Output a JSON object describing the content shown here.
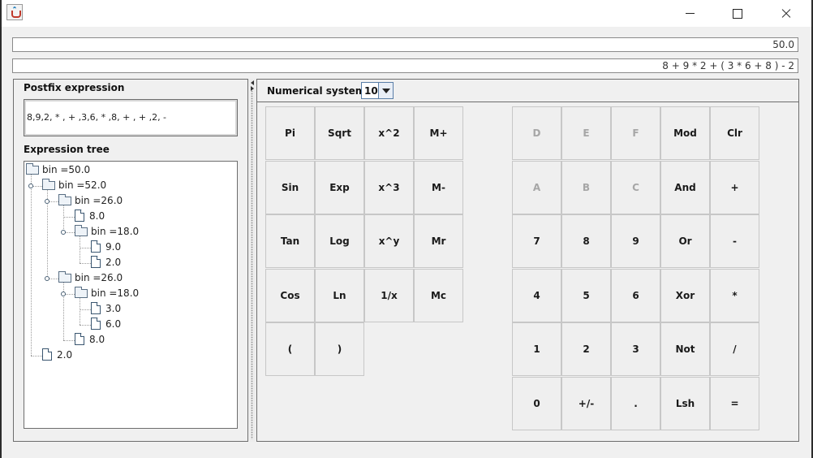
{
  "window": {
    "minimize_icon": "minimize-icon",
    "maximize_icon": "maximize-icon",
    "close_icon": "close-icon",
    "app_icon": "java-app-icon"
  },
  "display": {
    "result": "50.0",
    "expression": "8 + 9 * 2 + ( 3 * 6 + 8 ) - 2"
  },
  "postfix": {
    "title": "Postfix expression",
    "value": "8,9,2, * , + ,3,6, * ,8, + , + ,2, -"
  },
  "tree": {
    "title": "Expression tree",
    "nodes": [
      {
        "label": "bin =50.0",
        "kind": "folder"
      },
      {
        "label": "bin =52.0",
        "kind": "folder"
      },
      {
        "label": "bin =26.0",
        "kind": "folder"
      },
      {
        "label": "8.0",
        "kind": "file"
      },
      {
        "label": "bin =18.0",
        "kind": "folder"
      },
      {
        "label": "9.0",
        "kind": "file"
      },
      {
        "label": "2.0",
        "kind": "file"
      },
      {
        "label": "bin =26.0",
        "kind": "folder"
      },
      {
        "label": "bin =18.0",
        "kind": "folder"
      },
      {
        "label": "3.0",
        "kind": "file"
      },
      {
        "label": "6.0",
        "kind": "file"
      },
      {
        "label": "8.0",
        "kind": "file"
      },
      {
        "label": "2.0",
        "kind": "file"
      }
    ]
  },
  "numerical_system": {
    "label": "Numerical system",
    "value": "10"
  },
  "buttons": {
    "scientific": [
      [
        "Pi",
        "Sqrt",
        "x^2",
        "M+"
      ],
      [
        "Sin",
        "Exp",
        "x^3",
        "M-"
      ],
      [
        "Tan",
        "Log",
        "x^y",
        "Mr"
      ],
      [
        "Cos",
        "Ln",
        "1/x",
        "Mc"
      ],
      [
        "(",
        ")"
      ]
    ],
    "keypad": [
      [
        "D",
        "E",
        "F",
        "Mod",
        "Clr"
      ],
      [
        "A",
        "B",
        "C",
        "And",
        "+"
      ],
      [
        "7",
        "8",
        "9",
        "Or",
        "-"
      ],
      [
        "4",
        "5",
        "6",
        "Xor",
        "*"
      ],
      [
        "1",
        "2",
        "3",
        "Not",
        "/"
      ],
      [
        "0",
        "+/-",
        ".",
        "Lsh",
        "="
      ]
    ],
    "disabled": [
      "D",
      "E",
      "F",
      "A",
      "B",
      "C"
    ]
  }
}
